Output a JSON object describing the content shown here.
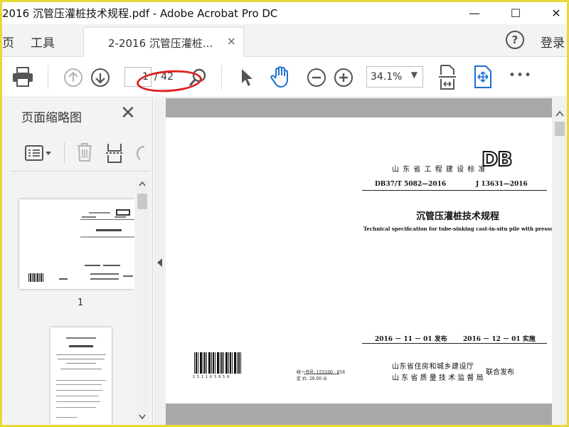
{
  "window": {
    "title": "2016 沉管压灌桩技术规程.pdf - Adobe Acrobat Pro DC",
    "minimize": "—",
    "maximize": "☐",
    "close": "✕"
  },
  "tabs": {
    "home": "页",
    "tools": "工具",
    "document_tab": "2-2016 沉管压灌桩...",
    "document_tab_close": "×",
    "help": "?",
    "login": "登录"
  },
  "toolbar": {
    "current_page": "1",
    "total_pages": "/ 42",
    "zoom": "34.1%",
    "zoom_arrow": "▼",
    "more": "•••",
    "accent_color": "#1a6fd1"
  },
  "left_panel": {
    "title": "页面缩略图",
    "close": "✕",
    "thumbnail_1_label": "1"
  },
  "document": {
    "province_standard": "山 东 省 工 程 建 设 标 准",
    "db_mark": "DB",
    "code_db": "DB37/T 5082—2016",
    "code_j": "J 13631—2016",
    "title_cn": "沉管压灌桩技术规程",
    "title_en": "Technical specification for tube-sinking cast-in-situ pile with pressure grouting concrete",
    "issue_date": "2016 － 11 － 01 发布",
    "effective_date": "2016 － 12 － 01 实施",
    "issuer_1": "山东省住房和城乡建设厅",
    "issuer_2": "山 东 省 质 量 技 术 监 督 局",
    "joint_release": "联合发布",
    "barcode_number": "1 5 1 1 6 5 8 5 8",
    "book_number": "统一书号: 155160 · 858",
    "price": "定    价:    28.00 元"
  }
}
